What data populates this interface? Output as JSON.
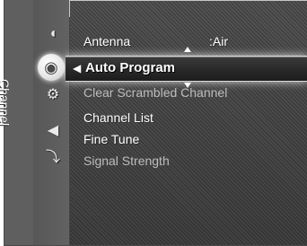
{
  "sidebar_tab": {
    "label": "Channel"
  },
  "icons": [
    {
      "name": "antenna-icon",
      "glyph": "◖"
    },
    {
      "name": "channel-disc-icon",
      "glyph": "◉"
    },
    {
      "name": "gear-icon",
      "glyph": "⚙"
    },
    {
      "name": "speaker-icon",
      "glyph": "◀"
    },
    {
      "name": "input-icon",
      "glyph": "⤵"
    }
  ],
  "menu": {
    "items": [
      {
        "label": "Antenna",
        "value": ":Air",
        "enabled": true
      },
      {
        "label": "Auto Program",
        "enabled": true,
        "selected": true
      },
      {
        "label": "Clear Scrambled Channel",
        "enabled": false
      },
      {
        "label": "Channel List",
        "enabled": true
      },
      {
        "label": "Fine Tune",
        "enabled": true
      },
      {
        "label": "Signal Strength",
        "enabled": false
      }
    ]
  }
}
